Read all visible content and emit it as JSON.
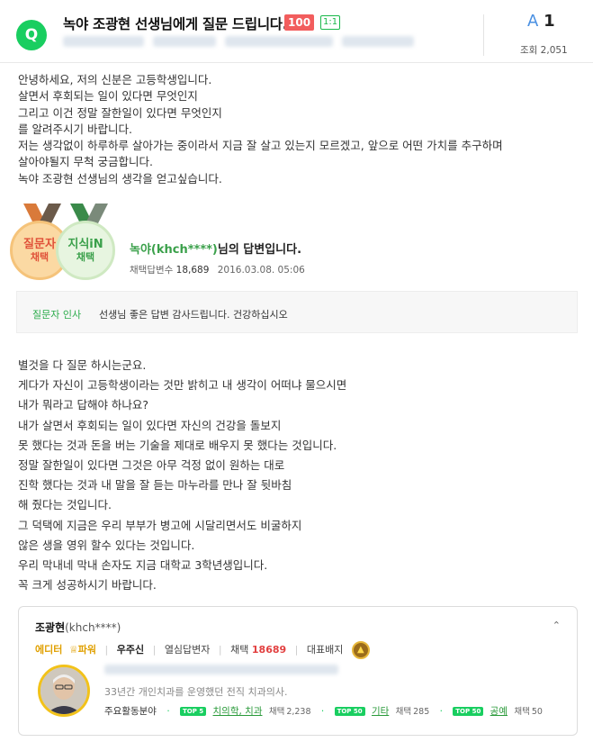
{
  "question": {
    "icon_letter": "Q",
    "title": "녹야 조광현 선생님에게 질문 드립니다.",
    "coin": "100",
    "ratio": "1:1",
    "answer_prefix": "A",
    "answer_count": "1",
    "views_label": "조회",
    "views": "2,051",
    "body": [
      "안녕하세요, 저의 신분은 고등학생입니다.",
      "살면서 후회되는 일이 있다면 무엇인지",
      "그리고 이건 정말 잘한일이 있다면 무엇인지",
      "를 알려주시기 바랍니다.",
      "저는 생각없이 하루하루 살아가는 중이라서 지금 잘 살고 있는지 모르겠고, 앞으로 어떤 가치를 추구하며",
      "살아야될지 무척 궁금합니다.",
      "녹야 조광현 선생님의 생각을 얻고싶습니다."
    ]
  },
  "answer": {
    "badge_questioner": {
      "line1": "질문자",
      "line2": "채택"
    },
    "badge_kin": {
      "line1": "지식iN",
      "line2": "채택"
    },
    "author_display": "녹야(khch****)",
    "author_suffix": "님의 답변입니다.",
    "meta_label": "채택답변수",
    "meta_count": "18,689",
    "meta_date": "2016.03.08. 05:06",
    "thanks_label": "질문자 인사",
    "thanks_text": "선생님 좋은 답변 감사드립니다. 건강하십시오",
    "body": [
      "별것을 다 질문 하시는군요.",
      "게다가 자신이 고등학생이라는 것만 밝히고 내 생각이 어떠냐 물으시면",
      "내가 뭐라고 답해야 하나요?",
      "내가 살면서 후회되는 일이 있다면 자신의 건강을 돌보지",
      "못 했다는 것과 돈을 버는 기술을 제대로 배우지 못 했다는 것입니다.",
      "정말 잘한일이 있다면 그것은 아무 걱정 없이 원하는 대로",
      "진학 했다는 것과 내 말을 잘 듣는 마누라를 만나 잘 뒷바침",
      "해 줬다는 것입니다.",
      "그 덕택에 지금은 우리 부부가 병고에 시달리면서도 비굴하지",
      "않은 생을 영위 할수 있다는 것입니다.",
      "우리 막내네 막내 손자도 지금 대학교 3학년생입니다.",
      "꼭 크게 성공하시기 바랍니다."
    ]
  },
  "profile": {
    "name": "조광현",
    "id": "(khch****)",
    "role_editor": "에디터",
    "role_power": "파워",
    "rank": "우주신",
    "tag_active": "열심답변자",
    "adopt_label": "채택",
    "adopt_count": "18689",
    "rep_badge_label": "대표배지",
    "intro": "33년간 개인치과를 운영했던 전직 치과의사.",
    "fields_label": "주요활동분야",
    "fields": [
      {
        "rank": "TOP 5",
        "name": "치의학, 치과",
        "count_label": "채택",
        "count": "2,238"
      },
      {
        "rank": "TOP 50",
        "name": "기타",
        "count_label": "채택",
        "count": "285"
      },
      {
        "rank": "TOP 50",
        "name": "공예",
        "count_label": "채택",
        "count": "50"
      }
    ]
  },
  "colors": {
    "green": "#19ce60",
    "coin": "#f25d5d",
    "accent_blue": "#4a90e2"
  }
}
